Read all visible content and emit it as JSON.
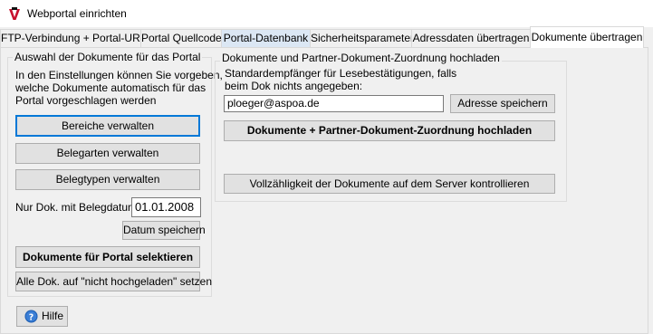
{
  "window": {
    "title": "Webportal einrichten",
    "icon": "app-logo-icon"
  },
  "tabs": [
    {
      "label": "FTP-Verbindung + Portal-URL"
    },
    {
      "label": "Portal Quellcode"
    },
    {
      "label": "Portal-Datenbank"
    },
    {
      "label": "Sicherheitsparameter"
    },
    {
      "label": "Adressdaten übertragen"
    },
    {
      "label": "Dokumente übertragen"
    }
  ],
  "left_group": {
    "title": "Auswahl der Dokumente für das Portal",
    "description_lines": [
      "In den Einstellungen können Sie vorgeben,",
      "welche Dokumente automatisch für das",
      "Portal vorgeschlagen werden"
    ],
    "bereiche_button": "Bereiche verwalten",
    "belegarten_button": "Belegarten verwalten",
    "belegtypen_button": "Belegtypen verwalten",
    "date_label": "Nur Dok. mit Belegdatum >",
    "date_value": "01.01.2008",
    "save_date_button": "Datum speichern",
    "select_button": "Dokumente für Portal selektieren",
    "reset_button": "Alle Dok. auf \"nicht hochgeladen\" setzen"
  },
  "right_group": {
    "title": "Dokumente und Partner-Dokument-Zuordnung hochladen",
    "recipient_label_lines": [
      "Standardempfänger für Lesebestätigungen, falls",
      "beim Dok nichts angegeben:"
    ],
    "email_value": "ploeger@aspoa.de",
    "save_address_button": "Adresse speichern",
    "upload_button": "Dokumente + Partner-Dokument-Zuordnung hochladen",
    "check_button": "Vollzähligkeit der Dokumente auf dem Server kontrollieren"
  },
  "help": {
    "label": "Hilfe",
    "icon": "help-question-icon"
  },
  "colors": {
    "accent": "#0078d7",
    "tab_highlight": "#dbe7f4",
    "help_icon": "#1e5fb4"
  }
}
